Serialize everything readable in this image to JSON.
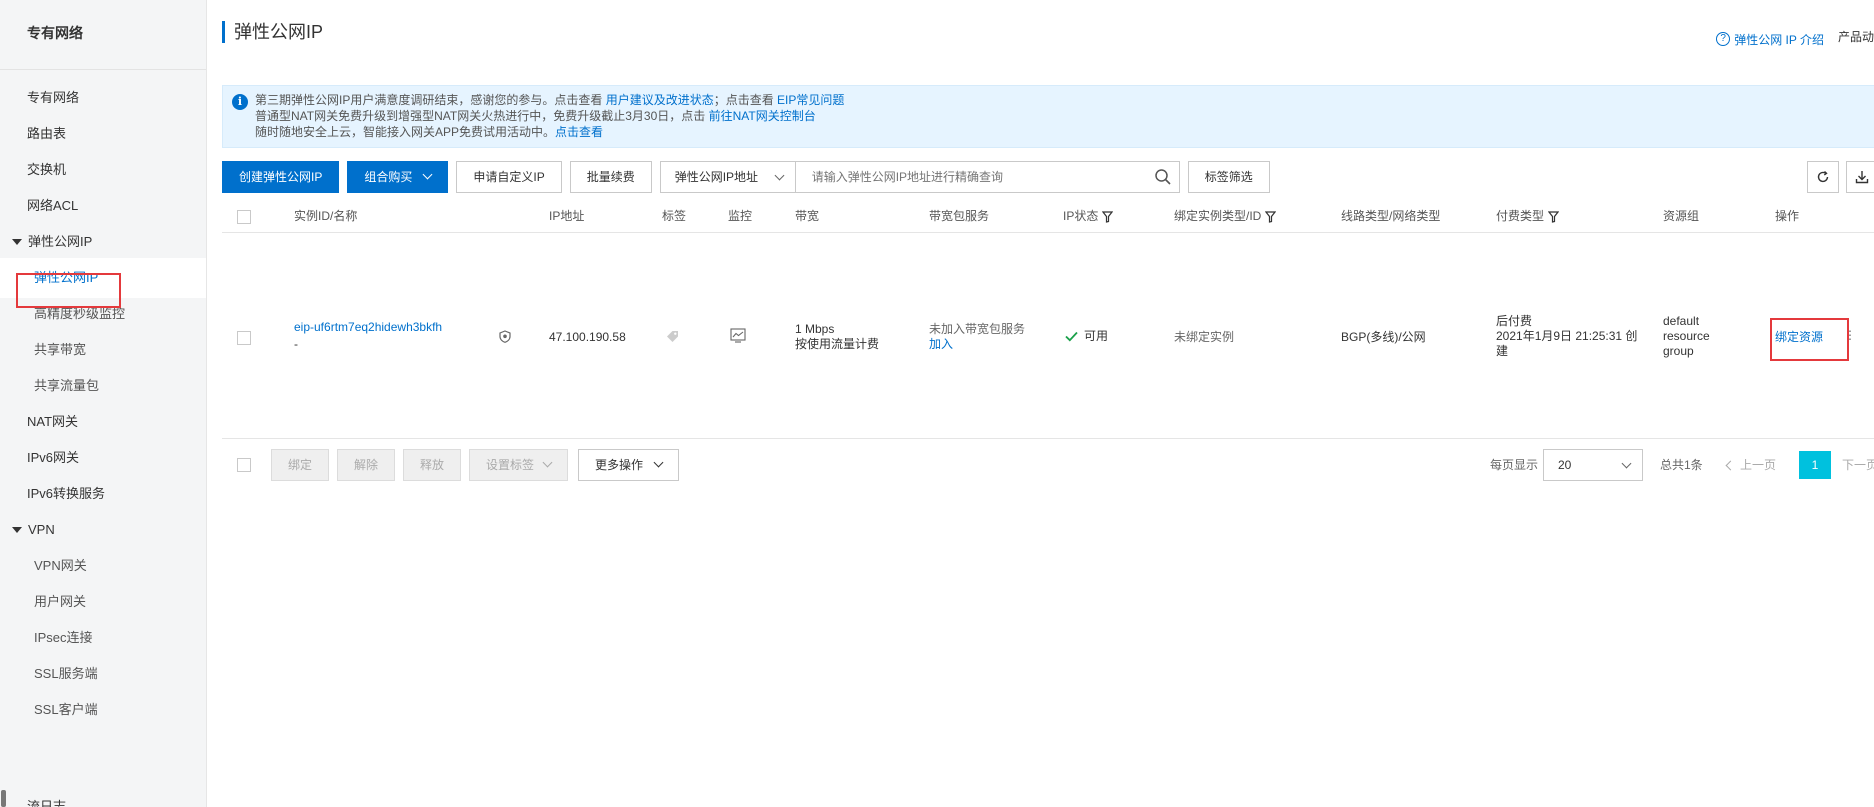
{
  "sidebar": {
    "title": "专有网络",
    "items": [
      {
        "label": "专有网络"
      },
      {
        "label": "路由表"
      },
      {
        "label": "交换机"
      },
      {
        "label": "网络ACL"
      },
      {
        "label": "弹性公网IP"
      },
      {
        "label": "弹性公网IP"
      },
      {
        "label": "高精度秒级监控"
      },
      {
        "label": "共享带宽"
      },
      {
        "label": "共享流量包"
      },
      {
        "label": "NAT网关"
      },
      {
        "label": "IPv6网关"
      },
      {
        "label": "IPv6转换服务"
      },
      {
        "label": "VPN"
      },
      {
        "label": "VPN网关"
      },
      {
        "label": "用户网关"
      },
      {
        "label": "IPsec连接"
      },
      {
        "label": "SSL服务端"
      },
      {
        "label": "SSL客户端"
      },
      {
        "label": "流日志"
      }
    ]
  },
  "header": {
    "title": "弹性公网IP",
    "help_link": "弹性公网 IP 介绍",
    "help_glyph": "?",
    "product_link": "产品动"
  },
  "notice": {
    "icon": "i",
    "line1_text": "第三期弹性公网IP用户满意度调研结束，感谢您的参与。点击查看 ",
    "line1_link1": "用户建议及改进状态",
    "line1_mid": "；点击查看 ",
    "line1_link2": "EIP常见问题",
    "line2_text": "普通型NAT网关免费升级到增强型NAT网关火热进行中，免费升级截止3月30日，点击 ",
    "line2_link": "前往NAT网关控制台",
    "line3_text": "随时随地安全上云，智能接入网关APP免费试用活动中。",
    "line3_link": "点击查看"
  },
  "toolbar": {
    "create": "创建弹性公网IP",
    "combo": "组合购买",
    "custom_ip": "申请自定义IP",
    "renew": "批量续费",
    "search_field": "弹性公网IP地址",
    "search_placeholder": "请输入弹性公网IP地址进行精确查询",
    "tag_filter": "标签筛选"
  },
  "table": {
    "headers": {
      "id": "实例ID/名称",
      "ip": "IP地址",
      "tag": "标签",
      "monitor": "监控",
      "bandwidth": "带宽",
      "package": "带宽包服务",
      "status": "IP状态",
      "bind": "绑定实例类型/ID",
      "line": "线路类型/网络类型",
      "pay": "付费类型",
      "group": "资源组",
      "ops": "操作"
    },
    "rows": [
      {
        "id": "eip-uf6rtm7eq2hidewh3bkfh",
        "name": "-",
        "ip": "47.100.190.58",
        "bandwidth": "1 Mbps",
        "billing": "按使用流量计费",
        "package": "未加入带宽包服务",
        "package_action": "加入",
        "status": "可用",
        "bind": "未绑定实例",
        "line": "BGP(多线)/公网",
        "pay_type": "后付费",
        "created_1": "2021年1月9日 21:25:31 创",
        "created_2": "建",
        "group_1": "default",
        "group_2": "resource",
        "group_3": "group",
        "action": "绑定资源"
      }
    ]
  },
  "footer": {
    "bind": "绑定",
    "unbind": "解除",
    "release": "释放",
    "set_tags": "设置标签",
    "more": "更多操作",
    "per_page_label": "每页显示",
    "per_page": "20",
    "total": "总共1条",
    "prev": "上一页",
    "page": "1",
    "next": "下一页"
  },
  "colors": {
    "primary": "#0070cc",
    "highlight_box": "#e4393c",
    "success": "#1aa04a",
    "page_active": "#00c1de"
  }
}
